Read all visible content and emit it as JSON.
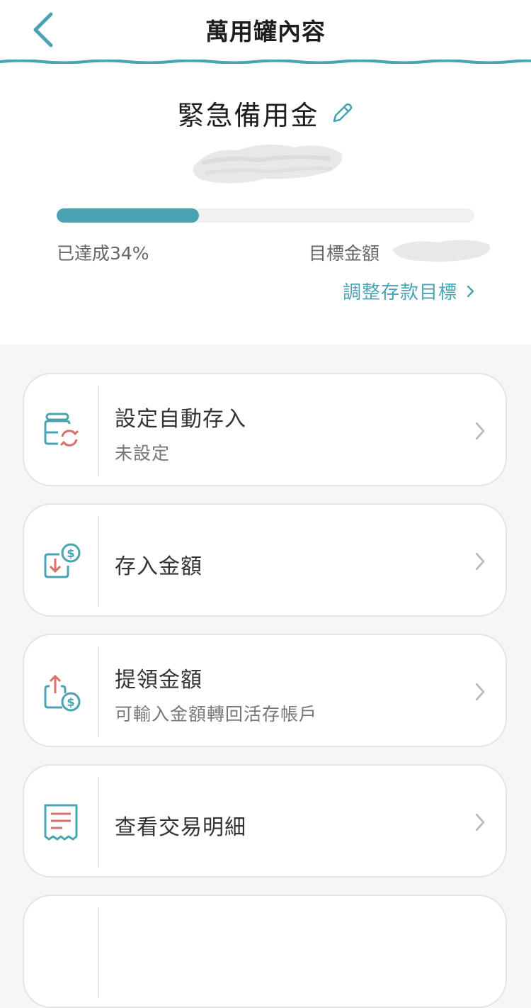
{
  "header": {
    "title": "萬用罐內容",
    "back_icon": "chevron-left-icon"
  },
  "summary": {
    "jar_name": "緊急備用金",
    "edit_icon": "pencil-icon",
    "progress_fraction": 0.34,
    "achieved_text": "已達成34%",
    "target_label": "目標金額",
    "adjust_link": "調整存款目標",
    "accent_color": "#4aa3b2"
  },
  "menu": {
    "items": [
      {
        "title": "設定自動存入",
        "subtitle": "未設定",
        "icon": "auto-deposit-icon"
      },
      {
        "title": "存入金額",
        "subtitle": "",
        "icon": "deposit-icon"
      },
      {
        "title": "提領金額",
        "subtitle": "可輸入金額轉回活存帳戶",
        "icon": "withdraw-icon"
      },
      {
        "title": "查看交易明細",
        "subtitle": "",
        "icon": "receipt-icon"
      }
    ]
  }
}
